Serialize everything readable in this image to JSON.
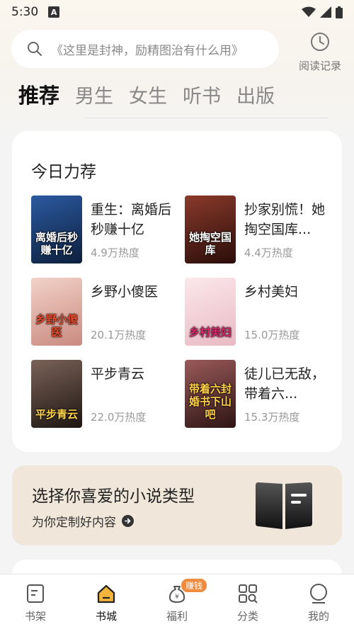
{
  "status": {
    "time": "5:30",
    "notification": "A"
  },
  "search": {
    "placeholder": "《这里是封神，励精图治有什么用》",
    "history_label": "阅读记录"
  },
  "tabs": [
    {
      "label": "推荐",
      "active": true
    },
    {
      "label": "男生",
      "active": false
    },
    {
      "label": "女生",
      "active": false
    },
    {
      "label": "听书",
      "active": false
    },
    {
      "label": "出版",
      "active": false
    }
  ],
  "recommend": {
    "title": "今日力荐",
    "books": [
      {
        "name": "重生：离婚后秒赚十亿",
        "heat": "4.9万热度",
        "cover_text": "离婚后秒赚十亿",
        "cover_color": "#1d3a6b"
      },
      {
        "name": "抄家别慌！她掏空国库...",
        "heat": "4.4万热度",
        "cover_text": "她掏空国库",
        "cover_color": "#5a1f1a"
      },
      {
        "name": "乡野小傻医",
        "heat": "20.1万热度",
        "cover_text": "乡野小傻医",
        "cover_color": "#d8a9a0"
      },
      {
        "name": "乡村美妇",
        "heat": "15.0万热度",
        "cover_text": "乡村美妇",
        "cover_color": "#f3d6dc"
      },
      {
        "name": "平步青云",
        "heat": "22.0万热度",
        "cover_text": "平步青云",
        "cover_color": "#4a3a35"
      },
      {
        "name": "徒儿已无敌，带着六...",
        "heat": "15.3万热度",
        "cover_text": "带着六封婚书下山吧",
        "cover_color": "#6a3a3a"
      }
    ]
  },
  "category": {
    "title": "选择你喜爱的小说类型",
    "subtitle": "为你定制好内容"
  },
  "nav": [
    {
      "label": "书架",
      "icon": "bookshelf-icon",
      "active": false
    },
    {
      "label": "书城",
      "icon": "bookstore-icon",
      "active": true
    },
    {
      "label": "福利",
      "icon": "money-bag-icon",
      "active": false,
      "badge": "赚钱"
    },
    {
      "label": "分类",
      "icon": "category-grid-icon",
      "active": false
    },
    {
      "label": "我的",
      "icon": "profile-icon",
      "active": false
    }
  ],
  "colors": {
    "accent": "#f08a3c",
    "category_bg": "#f0e7da"
  }
}
